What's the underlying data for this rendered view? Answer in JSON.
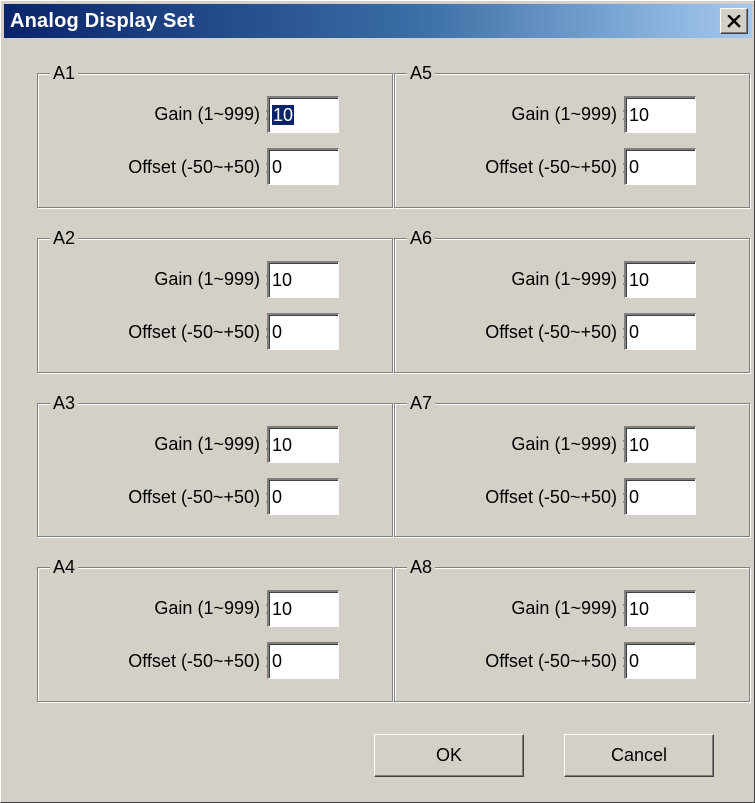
{
  "window": {
    "title": "Analog Display Set",
    "close_icon": "close-x-icon"
  },
  "groups": [
    {
      "label": "A1",
      "gain_label": "Gain (1~999) :",
      "gain_value": "10",
      "offset_label": "Offset (-50~+50) :",
      "offset_value": "0"
    },
    {
      "label": "A2",
      "gain_label": "Gain (1~999) :",
      "gain_value": "10",
      "offset_label": "Offset (-50~+50) :",
      "offset_value": "0"
    },
    {
      "label": "A3",
      "gain_label": "Gain (1~999) :",
      "gain_value": "10",
      "offset_label": "Offset (-50~+50) :",
      "offset_value": "0"
    },
    {
      "label": "A4",
      "gain_label": "Gain (1~999) :",
      "gain_value": "10",
      "offset_label": "Offset (-50~+50) :",
      "offset_value": "0"
    },
    {
      "label": "A5",
      "gain_label": "Gain (1~999) :",
      "gain_value": "10",
      "offset_label": "Offset (-50~+50) :",
      "offset_value": "0"
    },
    {
      "label": "A6",
      "gain_label": "Gain (1~999) :",
      "gain_value": "10",
      "offset_label": "Offset (-50~+50) :",
      "offset_value": "0"
    },
    {
      "label": "A7",
      "gain_label": "Gain (1~999) :",
      "gain_value": "10",
      "offset_label": "Offset (-50~+50) :",
      "offset_value": "0"
    },
    {
      "label": "A8",
      "gain_label": "Gain (1~999) :",
      "gain_value": "10",
      "offset_label": "Offset (-50~+50) :",
      "offset_value": "0"
    }
  ],
  "buttons": {
    "ok_label": "OK",
    "cancel_label": "Cancel"
  },
  "colors": {
    "title_bar_start": "#0a246a",
    "title_bar_end": "#a6caf0",
    "face": "#d4d0c8",
    "selection": "#0a246a"
  }
}
